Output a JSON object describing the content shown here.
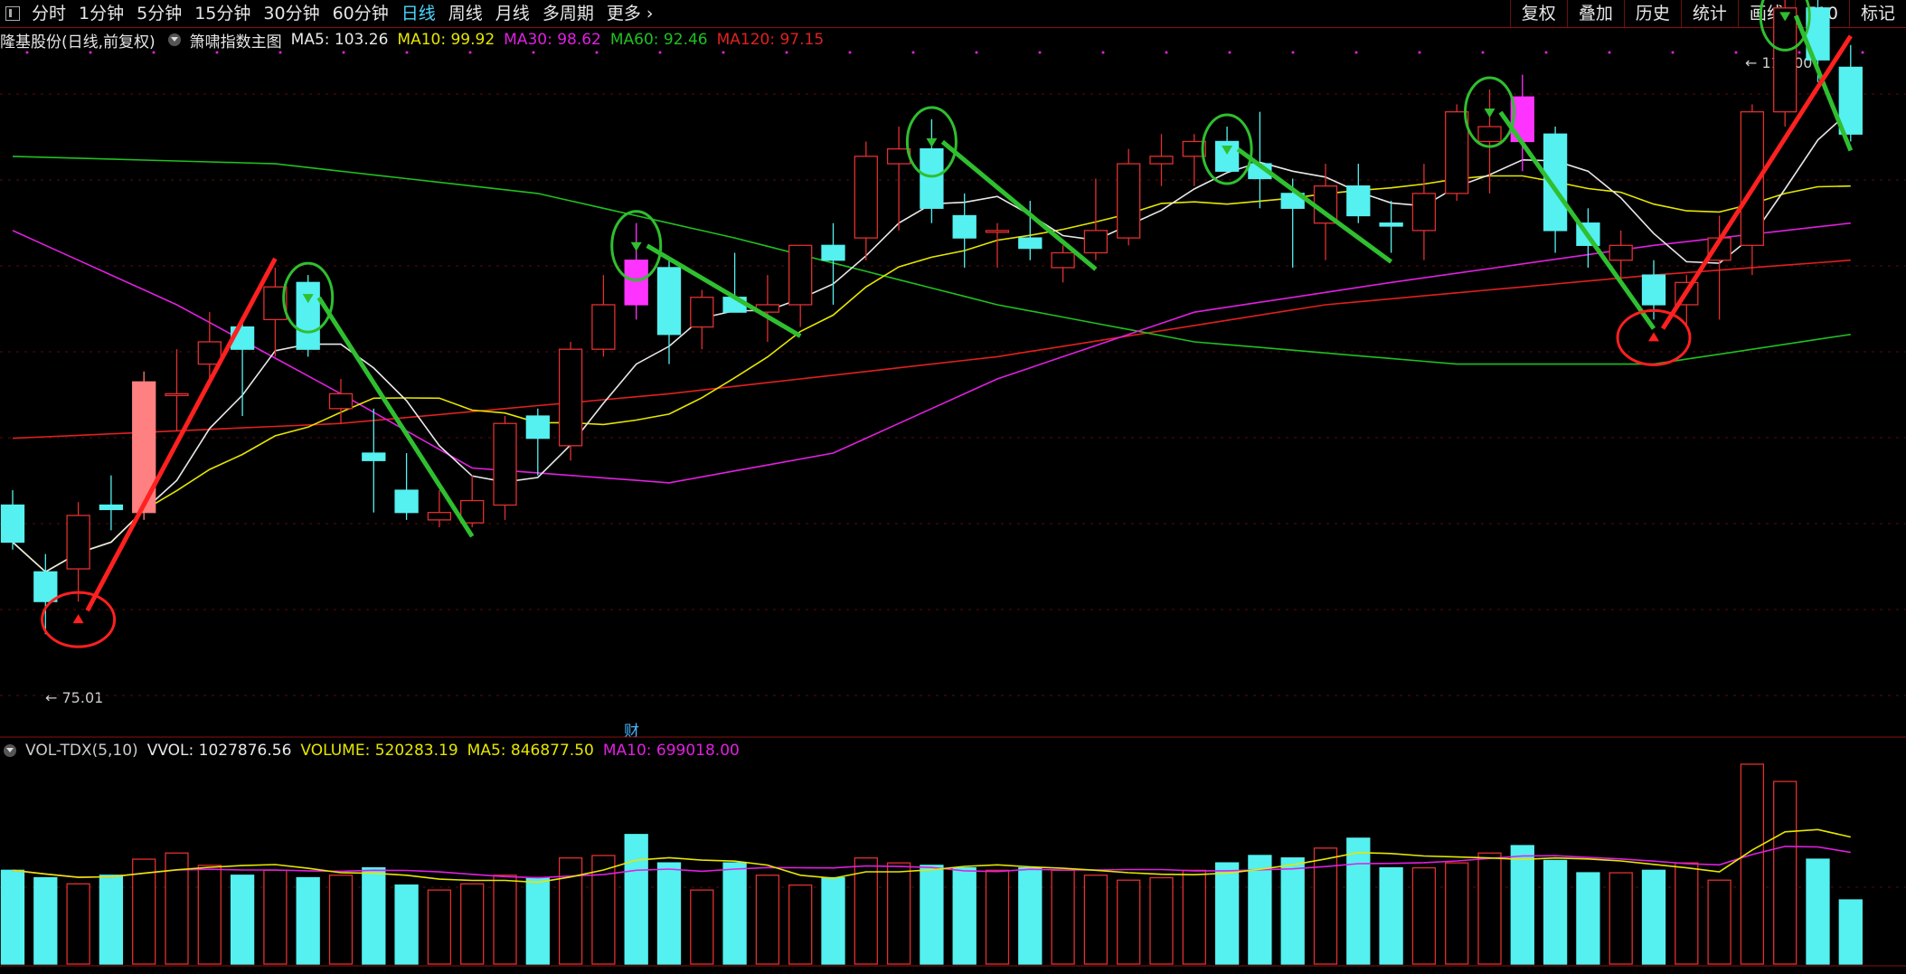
{
  "toolbar": {
    "periods": [
      {
        "label": "分时",
        "active": false
      },
      {
        "label": "1分钟",
        "active": false
      },
      {
        "label": "5分钟",
        "active": false
      },
      {
        "label": "15分钟",
        "active": false
      },
      {
        "label": "30分钟",
        "active": false
      },
      {
        "label": "60分钟",
        "active": false
      },
      {
        "label": "日线",
        "active": true
      },
      {
        "label": "周线",
        "active": false
      },
      {
        "label": "月线",
        "active": false
      },
      {
        "label": "多周期",
        "active": false
      },
      {
        "label": "更多",
        "active": false
      }
    ],
    "right_items": [
      "复权",
      "叠加",
      "历史",
      "统计",
      "画线",
      "F10",
      "标记"
    ]
  },
  "main_chart": {
    "stock_title": "隆基股份(日线,前复权)",
    "indicator_name": "箫啸指数主图",
    "ma_values": [
      {
        "label": "MA5: 103.26",
        "color": "#e8e8e8"
      },
      {
        "label": "MA10: 99.92",
        "color": "#e6e600"
      },
      {
        "label": "MA30: 98.62",
        "color": "#e020e0"
      },
      {
        "label": "MA60: 92.46",
        "color": "#20c020"
      },
      {
        "label": "MA120: 97.15",
        "color": "#e02020"
      }
    ],
    "high_label": "113.00",
    "low_label": "75.01",
    "finance_marker": "财"
  },
  "volume_chart": {
    "indicator": "VOL-TDX(5,10)",
    "vvol": "VVOL: 1027876.56",
    "volume": "VOLUME: 520283.19",
    "ma5": "MA5: 846877.50",
    "ma10": "MA10: 699018.00",
    "colors": {
      "vvol": "#e8e8e8",
      "volume": "#e6e600",
      "ma5": "#e6e600",
      "ma10": "#e020e0"
    }
  },
  "colors": {
    "up": "#e03030",
    "down": "#55f0f0",
    "marked_down": "#ff33ff",
    "marked_up": "#ff8080",
    "sell_signal": "#2fbf2f",
    "buy_signal": "#ff2020",
    "background": "#000000"
  },
  "chart_data": {
    "type": "candlestick",
    "ylim": [
      72,
      116
    ],
    "candles": [
      {
        "o": 85.5,
        "h": 86.5,
        "l": 82.5,
        "c": 83.0
      },
      {
        "o": 81.0,
        "h": 82.2,
        "l": 76.8,
        "c": 79.0
      },
      {
        "o": 81.2,
        "h": 85.7,
        "l": 79.0,
        "c": 84.8
      },
      {
        "o": 85.5,
        "h": 87.5,
        "l": 83.8,
        "c": 85.2
      },
      {
        "o": 85.0,
        "h": 94.5,
        "l": 84.5,
        "c": 93.8,
        "mark": "up"
      },
      {
        "o": 93.0,
        "h": 96.0,
        "l": 90.5,
        "c": 93.0
      },
      {
        "o": 95.0,
        "h": 98.5,
        "l": 94.0,
        "c": 96.5
      },
      {
        "o": 97.5,
        "h": 98.2,
        "l": 91.5,
        "c": 96.0
      },
      {
        "o": 98.0,
        "h": 101.5,
        "l": 95.5,
        "c": 100.2
      },
      {
        "o": 100.5,
        "h": 101.0,
        "l": 95.5,
        "c": 96.0
      },
      {
        "o": 92.0,
        "h": 94.0,
        "l": 91.0,
        "c": 93.0
      },
      {
        "o": 89.0,
        "h": 92.0,
        "l": 85.0,
        "c": 88.5
      },
      {
        "o": 86.5,
        "h": 89.0,
        "l": 84.5,
        "c": 85.0
      },
      {
        "o": 84.5,
        "h": 86.5,
        "l": 84.0,
        "c": 85.0
      },
      {
        "o": 84.3,
        "h": 87.5,
        "l": 84.0,
        "c": 85.8
      },
      {
        "o": 85.5,
        "h": 91.5,
        "l": 84.5,
        "c": 91.0
      },
      {
        "o": 91.5,
        "h": 92.0,
        "l": 87.5,
        "c": 90.0
      },
      {
        "o": 89.5,
        "h": 96.5,
        "l": 88.5,
        "c": 96.0
      },
      {
        "o": 96.0,
        "h": 101.0,
        "l": 95.5,
        "c": 99.0
      },
      {
        "o": 102.0,
        "h": 104.5,
        "l": 98.0,
        "c": 99.0,
        "mark": "down"
      },
      {
        "o": 101.5,
        "h": 102.0,
        "l": 95.0,
        "c": 97.0
      },
      {
        "o": 97.5,
        "h": 100.0,
        "l": 96.0,
        "c": 99.5
      },
      {
        "o": 99.5,
        "h": 102.5,
        "l": 98.5,
        "c": 98.5
      },
      {
        "o": 98.5,
        "h": 101.0,
        "l": 96.5,
        "c": 99.0
      },
      {
        "o": 99.0,
        "h": 103.0,
        "l": 97.5,
        "c": 103.0
      },
      {
        "o": 103.0,
        "h": 104.5,
        "l": 99.0,
        "c": 102.0
      },
      {
        "o": 103.5,
        "h": 110.0,
        "l": 102.0,
        "c": 109.0
      },
      {
        "o": 108.5,
        "h": 111.0,
        "l": 104.0,
        "c": 109.5
      },
      {
        "o": 109.5,
        "h": 111.5,
        "l": 104.5,
        "c": 105.5
      },
      {
        "o": 105.0,
        "h": 106.5,
        "l": 101.5,
        "c": 103.5
      },
      {
        "o": 104.0,
        "h": 104.5,
        "l": 101.5,
        "c": 104.0
      },
      {
        "o": 103.5,
        "h": 106.0,
        "l": 102.0,
        "c": 102.8
      },
      {
        "o": 101.5,
        "h": 103.0,
        "l": 100.5,
        "c": 102.5
      },
      {
        "o": 102.5,
        "h": 107.5,
        "l": 102.0,
        "c": 104.0
      },
      {
        "o": 103.5,
        "h": 109.5,
        "l": 103.0,
        "c": 108.5
      },
      {
        "o": 108.5,
        "h": 110.5,
        "l": 107.0,
        "c": 109.0
      },
      {
        "o": 109.0,
        "h": 110.5,
        "l": 107.0,
        "c": 110.0
      },
      {
        "o": 110.0,
        "h": 111.0,
        "l": 108.0,
        "c": 108.0
      },
      {
        "o": 108.5,
        "h": 112.0,
        "l": 105.5,
        "c": 107.5
      },
      {
        "o": 106.5,
        "h": 107.5,
        "l": 101.5,
        "c": 105.5
      },
      {
        "o": 104.5,
        "h": 108.5,
        "l": 102.0,
        "c": 107.0
      },
      {
        "o": 107.0,
        "h": 108.5,
        "l": 104.5,
        "c": 105.0
      },
      {
        "o": 104.5,
        "h": 106.0,
        "l": 102.5,
        "c": 104.3
      },
      {
        "o": 104.0,
        "h": 108.5,
        "l": 102.0,
        "c": 106.5
      },
      {
        "o": 106.5,
        "h": 112.5,
        "l": 106.0,
        "c": 112.0
      },
      {
        "o": 110.0,
        "h": 113.5,
        "l": 106.5,
        "c": 111.0
      },
      {
        "o": 113.0,
        "h": 114.5,
        "l": 108.0,
        "c": 110.0,
        "mark": "down"
      },
      {
        "o": 110.5,
        "h": 111.0,
        "l": 102.5,
        "c": 104.0
      },
      {
        "o": 104.5,
        "h": 105.5,
        "l": 101.5,
        "c": 103.0
      },
      {
        "o": 102.0,
        "h": 104.0,
        "l": 100.5,
        "c": 103.0
      },
      {
        "o": 101.0,
        "h": 102.0,
        "l": 98.0,
        "c": 99.0
      },
      {
        "o": 99.0,
        "h": 101.0,
        "l": 97.5,
        "c": 100.5
      },
      {
        "o": 102.0,
        "h": 105.0,
        "l": 98.0,
        "c": 103.5
      },
      {
        "o": 103.0,
        "h": 112.5,
        "l": 101.0,
        "c": 112.0
      },
      {
        "o": 112.0,
        "h": 120.0,
        "l": 111.0,
        "c": 119.0
      },
      {
        "o": 119.0,
        "h": 120.5,
        "l": 114.0,
        "c": 115.5
      },
      {
        "o": 115.0,
        "h": 116.5,
        "l": 110.0,
        "c": 110.5
      }
    ],
    "volume": [
      760,
      700,
      650,
      720,
      850,
      900,
      800,
      720,
      760,
      700,
      720,
      780,
      640,
      600,
      650,
      720,
      700,
      860,
      880,
      1050,
      820,
      600,
      820,
      720,
      640,
      700,
      860,
      820,
      800,
      780,
      760,
      780,
      760,
      720,
      680,
      700,
      760,
      820,
      880,
      860,
      940,
      1020,
      780,
      780,
      820,
      900,
      960,
      840,
      740,
      740,
      760,
      820,
      680,
      1620,
      1480,
      850,
      520
    ],
    "sell_signal_indices": [
      9,
      19,
      28,
      37,
      45,
      54
    ],
    "buy_signal_indices": [
      2,
      50
    ]
  }
}
